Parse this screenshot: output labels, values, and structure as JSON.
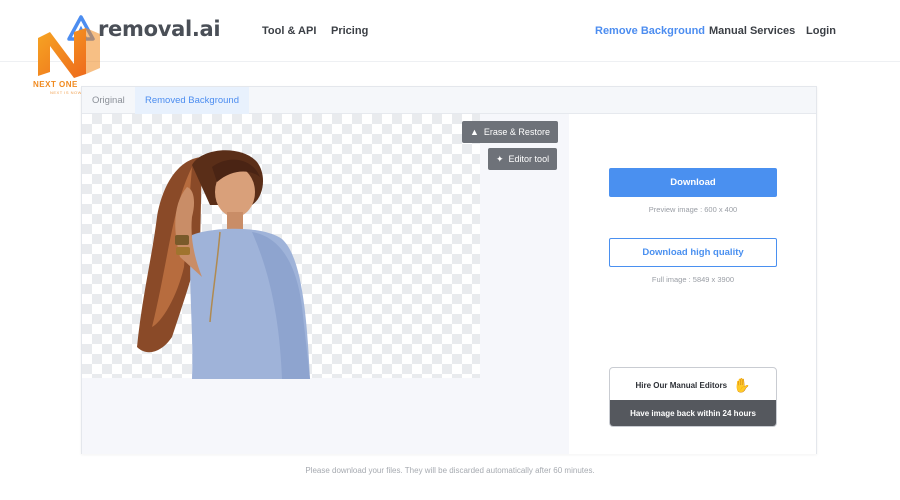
{
  "header": {
    "logo_text": "removal.ai",
    "nav": [
      {
        "label": "Tool & API"
      },
      {
        "label": "Pricing"
      },
      {
        "label": "Remove Background"
      },
      {
        "label": "Manual Services"
      },
      {
        "label": "Login"
      }
    ],
    "active_color": "#4c8df0"
  },
  "watermark": {
    "text": "NEXT ONE",
    "subtext": "NEXT IS NOW",
    "color": "#f08a1f"
  },
  "tabs": [
    {
      "label": "Original"
    },
    {
      "label": "Removed Background"
    }
  ],
  "tools": {
    "erase_restore": "Erase & Restore",
    "editor_tool": "Editor tool"
  },
  "download": {
    "button_label": "Download",
    "preview_caption": "Preview image : 600 x 400",
    "hq_button_label": "Download high quality",
    "full_caption": "Full image : 5849 x 3900"
  },
  "hire": {
    "title": "Hire Our Manual Editors",
    "subtitle": "Have image back within 24 hours",
    "icon": "waving-hand-icon"
  },
  "footer": {
    "note": "Please download your files. They will be discarded automatically after 60 minutes."
  },
  "colors": {
    "primary": "#4a90f0",
    "dark_button": "#6e7279"
  }
}
